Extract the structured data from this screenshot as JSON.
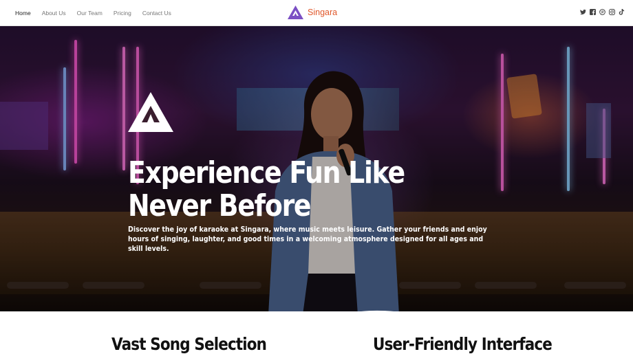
{
  "nav": {
    "items": [
      {
        "label": "Home",
        "active": true
      },
      {
        "label": "About Us"
      },
      {
        "label": "Our Team"
      },
      {
        "label": "Pricing"
      },
      {
        "label": "Contact Us"
      }
    ]
  },
  "brand": {
    "name": "Singara",
    "logo_icon": "triangle-logo-icon",
    "color": "#e0582b",
    "logo_color": "#7b4fc4"
  },
  "social": [
    "twitter-icon",
    "facebook-icon",
    "pinterest-icon",
    "instagram-icon",
    "tiktok-icon"
  ],
  "hero": {
    "title": "Experience Fun Like Never Before",
    "description": "Discover the joy of karaoke at Singara, where music meets leisure. Gather your friends and enjoy hours of singing, laughter, and good times in a welcoming atmosphere designed for all ages and skill levels."
  },
  "features": [
    {
      "title": "Vast Song Selection"
    },
    {
      "title": "User-Friendly Interface"
    }
  ]
}
